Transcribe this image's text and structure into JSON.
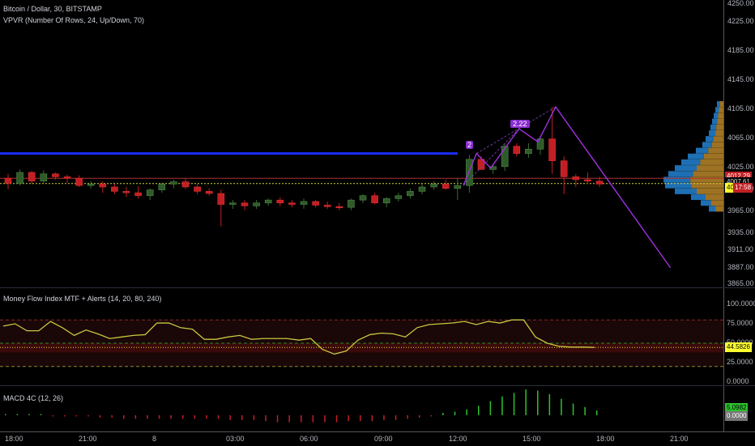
{
  "header": {
    "title": "Bitcoin / Dollar, 30, BITSTAMP",
    "indicator": "VPVR (Number Of Rows, 24, Up/Down, 70)"
  },
  "price_axis": {
    "ticks": [
      "4250.00",
      "4225.00",
      "4185.00",
      "4145.00",
      "4105.00",
      "4065.00",
      "4025.00",
      "3995.00",
      "3965.00",
      "3935.00",
      "3911.00",
      "3887.00",
      "3865.00"
    ],
    "tags": {
      "high": "4012.29",
      "mid": "4007.61",
      "last": "4002.7",
      "last_label": "17:58"
    }
  },
  "mfi": {
    "legend": "Money Flow Index MTF + Alerts (14, 20, 80, 240)",
    "ticks": [
      "100.0000",
      "75.0000",
      "50.0000",
      "25.0000",
      "0.0000"
    ],
    "value_tag": "44.5826",
    "values": [
      72,
      75,
      66,
      66,
      78,
      70,
      60,
      67,
      62,
      56,
      58,
      60,
      61,
      76,
      76,
      70,
      68,
      55,
      55,
      58,
      60,
      55,
      56,
      56,
      56,
      54,
      56,
      42,
      36,
      40,
      54,
      61,
      63,
      62,
      58,
      70,
      74,
      75,
      76,
      78,
      74,
      78,
      76,
      80,
      80,
      58,
      50,
      46,
      45,
      45,
      44.58
    ]
  },
  "macd": {
    "legend": "MACD 4C (12, 26)",
    "tags": {
      "value": "5.0982",
      "zero": "0.0000"
    },
    "hist": [
      1,
      1,
      1,
      1,
      -1,
      -1,
      -1,
      -1,
      -2,
      -2,
      -3,
      -3,
      -3,
      -3,
      -3,
      -3,
      -3,
      -3,
      -3,
      -4,
      -4,
      -4,
      -5,
      -6,
      -6,
      -6,
      -6,
      -6,
      -6,
      -5,
      -5,
      -5,
      -4,
      -4,
      -3,
      -2,
      -1,
      2,
      3,
      5,
      8,
      12,
      16,
      19,
      22,
      21,
      18,
      14,
      10,
      7,
      4
    ]
  },
  "time_axis": {
    "ticks": [
      "18:00",
      "21:00",
      "8",
      "03:00",
      "06:00",
      "09:00",
      "12:00",
      "15:00",
      "18:00",
      "21:00"
    ]
  },
  "pattern_labels": {
    "a": "2",
    "b": "2.22"
  },
  "chart_data": {
    "type": "candlestick",
    "title": "Bitcoin / Dollar, 30, BITSTAMP",
    "ylim": [
      3860,
      4255
    ],
    "x_labels": [
      "18:00",
      "21:00",
      "8",
      "03:00",
      "06:00",
      "09:00",
      "12:00",
      "15:00",
      "18:00",
      "21:00"
    ],
    "candles": [
      [
        4010,
        4016,
        3995,
        4003
      ],
      [
        4003,
        4022,
        4000,
        4018
      ],
      [
        4018,
        4020,
        4002,
        4006
      ],
      [
        4006,
        4021,
        4004,
        4016
      ],
      [
        4016,
        4018,
        4008,
        4012
      ],
      [
        4012,
        4015,
        4004,
        4010
      ],
      [
        4010,
        4014,
        3998,
        4000
      ],
      [
        4000,
        4006,
        3996,
        4002
      ],
      [
        4002,
        4006,
        3990,
        3998
      ],
      [
        3998,
        4002,
        3988,
        3992
      ],
      [
        3992,
        3998,
        3984,
        3990
      ],
      [
        3990,
        3999,
        3982,
        3986
      ],
      [
        3986,
        3996,
        3980,
        3994
      ],
      [
        3994,
        4004,
        3990,
        4002
      ],
      [
        4002,
        4008,
        3996,
        4005
      ],
      [
        4005,
        4010,
        3995,
        3998
      ],
      [
        3998,
        4002,
        3988,
        3992
      ],
      [
        3992,
        3996,
        3986,
        3989
      ],
      [
        3989,
        3994,
        3944,
        3974
      ],
      [
        3974,
        3980,
        3968,
        3976
      ],
      [
        3976,
        3980,
        3966,
        3972
      ],
      [
        3972,
        3980,
        3968,
        3976
      ],
      [
        3976,
        3982,
        3972,
        3980
      ],
      [
        3980,
        3984,
        3972,
        3976
      ],
      [
        3976,
        3980,
        3970,
        3974
      ],
      [
        3974,
        3982,
        3968,
        3978
      ],
      [
        3978,
        3980,
        3970,
        3973
      ],
      [
        3973,
        3978,
        3968,
        3971
      ],
      [
        3971,
        3976,
        3966,
        3970
      ],
      [
        3970,
        3982,
        3966,
        3980
      ],
      [
        3980,
        3988,
        3976,
        3986
      ],
      [
        3986,
        3990,
        3974,
        3976
      ],
      [
        3976,
        3984,
        3970,
        3982
      ],
      [
        3982,
        3990,
        3978,
        3986
      ],
      [
        3986,
        3996,
        3982,
        3992
      ],
      [
        3992,
        4002,
        3988,
        3998
      ],
      [
        3998,
        4006,
        3994,
        4002
      ],
      [
        4002,
        4008,
        3994,
        3996
      ],
      [
        3996,
        4010,
        3980,
        4000
      ],
      [
        4000,
        4042,
        3990,
        4036
      ],
      [
        4036,
        4040,
        4026,
        4022
      ],
      [
        4022,
        4030,
        4016,
        4026
      ],
      [
        4026,
        4058,
        4020,
        4054
      ],
      [
        4054,
        4058,
        4040,
        4044
      ],
      [
        4044,
        4058,
        4038,
        4050
      ],
      [
        4050,
        4068,
        4042,
        4064
      ],
      [
        4064,
        4108,
        4016,
        4034
      ],
      [
        4034,
        4040,
        3988,
        4012
      ],
      [
        4012,
        4016,
        3998,
        4008
      ],
      [
        4008,
        4018,
        4002,
        4006
      ],
      [
        4006,
        4012,
        3998,
        4002
      ]
    ],
    "horizontal_levels": [
      4044,
      4010,
      4002.7
    ],
    "pattern_points": [
      [
        38.5,
        4000
      ],
      [
        39.6,
        4044
      ],
      [
        40.8,
        4024
      ],
      [
        43.2,
        4078
      ],
      [
        44.8,
        4060
      ],
      [
        46.3,
        4108
      ],
      [
        56,
        3887
      ]
    ]
  }
}
